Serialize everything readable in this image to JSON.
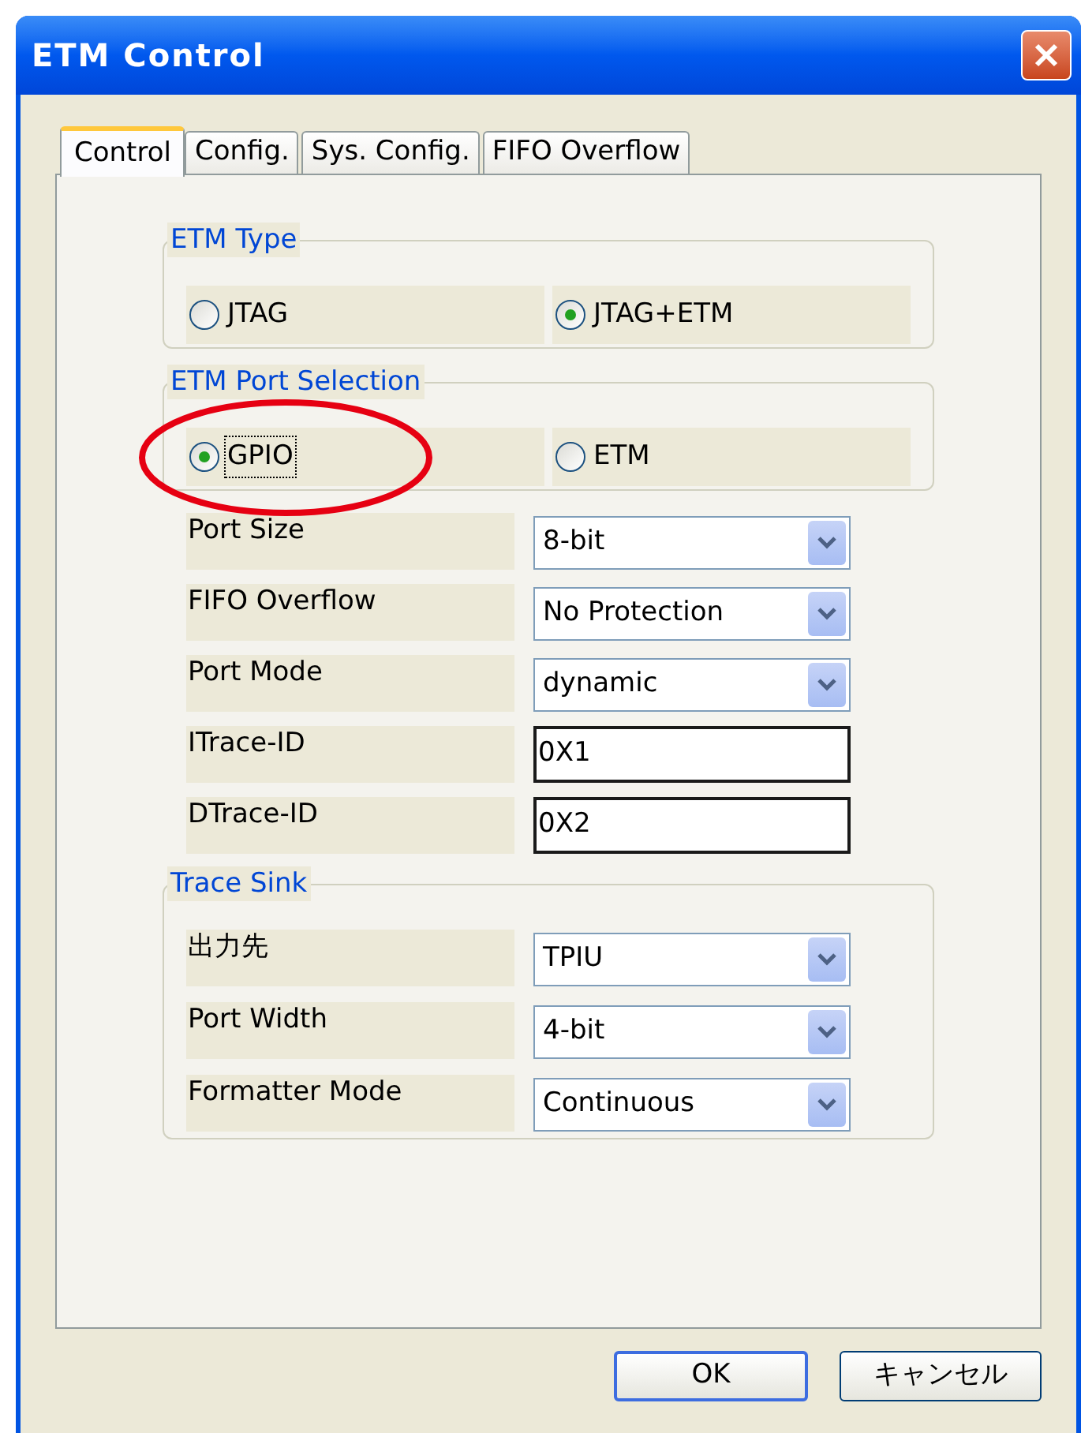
{
  "window": {
    "title": "ETM Control"
  },
  "tabs": [
    {
      "label": "Control",
      "selected": true
    },
    {
      "label": "Config.",
      "selected": false
    },
    {
      "label": "Sys. Config.",
      "selected": false
    },
    {
      "label": "FIFO Overflow",
      "selected": false
    }
  ],
  "etm_type": {
    "title": "ETM Type",
    "options": [
      {
        "label": "JTAG",
        "selected": false,
        "focused": false
      },
      {
        "label": "JTAG+ETM",
        "selected": true,
        "focused": false
      }
    ]
  },
  "etm_port_selection": {
    "title": "ETM Port Selection",
    "options": [
      {
        "label": "GPIO",
        "selected": true,
        "focused": true
      },
      {
        "label": "ETM",
        "selected": false,
        "focused": false
      }
    ]
  },
  "settings": [
    {
      "label": "Port Size",
      "kind": "dropdown",
      "value": "8-bit"
    },
    {
      "label": "FIFO Overflow",
      "kind": "dropdown",
      "value": "No Protection"
    },
    {
      "label": "Port Mode",
      "kind": "dropdown",
      "value": "dynamic"
    },
    {
      "label": "ITrace-ID",
      "kind": "text",
      "value": "0X1"
    },
    {
      "label": "DTrace-ID",
      "kind": "text",
      "value": "0X2"
    }
  ],
  "trace_sink": {
    "title": "Trace Sink",
    "settings": [
      {
        "label": "出力先",
        "kind": "dropdown",
        "value": "TPIU"
      },
      {
        "label": "Port Width",
        "kind": "dropdown",
        "value": "4-bit"
      },
      {
        "label": "Formatter Mode",
        "kind": "dropdown",
        "value": "Continuous"
      }
    ]
  },
  "buttons": [
    {
      "label": "OK",
      "default": true
    },
    {
      "label": "キャンセル",
      "default": false
    }
  ]
}
